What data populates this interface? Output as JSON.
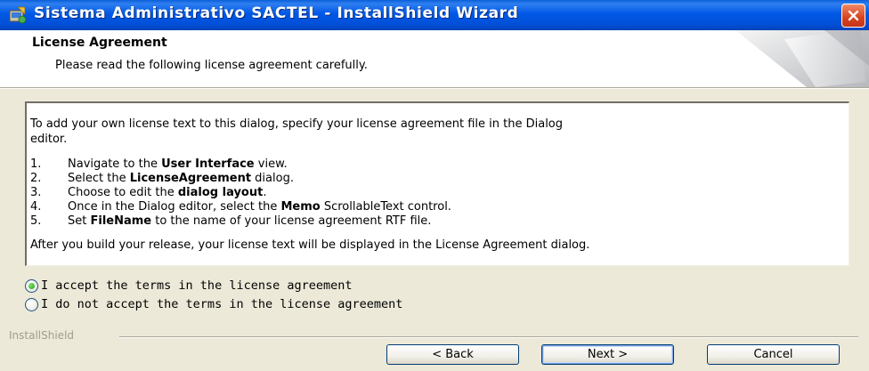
{
  "window": {
    "title": "Sistema Administrativo SACTEL - InstallShield Wizard"
  },
  "header": {
    "title": "License Agreement",
    "subtitle": "Please read the following license agreement carefully."
  },
  "license": {
    "intro_line1": "To add your own license text to this dialog, specify your license agreement file in the Dialog",
    "intro_line2": "editor.",
    "items": [
      {
        "num": "1.",
        "pre": "Navigate to the ",
        "bold": "User Interface",
        "post": " view."
      },
      {
        "num": "2.",
        "pre": "Select the ",
        "bold": "LicenseAgreement",
        "post": " dialog."
      },
      {
        "num": "3.",
        "pre": "Choose to edit the ",
        "bold": "dialog layout",
        "post": "."
      },
      {
        "num": "4.",
        "pre": "Once in the Dialog editor, select the ",
        "bold": "Memo",
        "post": " ScrollableText control."
      },
      {
        "num": "5.",
        "pre": "Set ",
        "bold": "FileName",
        "post": " to the name of your license agreement RTF file."
      }
    ],
    "outro": "After you build your release, your license text will be displayed in the License Agreement dialog."
  },
  "options": {
    "accept": "I accept the terms in the license agreement",
    "decline": "I do not accept the terms in the license agreement",
    "selected": "accept"
  },
  "footer": {
    "group_label": "InstallShield",
    "back": "< Back",
    "next": "Next >",
    "cancel": "Cancel"
  },
  "icons": [
    "installer-icon",
    "close-icon",
    "radio-selected-icon",
    "radio-unselected-icon"
  ],
  "colors": {
    "titlebar": "#0058e6",
    "close": "#d8431e",
    "dialog_bg": "#ece9d8",
    "radio_dot": "#21a121"
  }
}
